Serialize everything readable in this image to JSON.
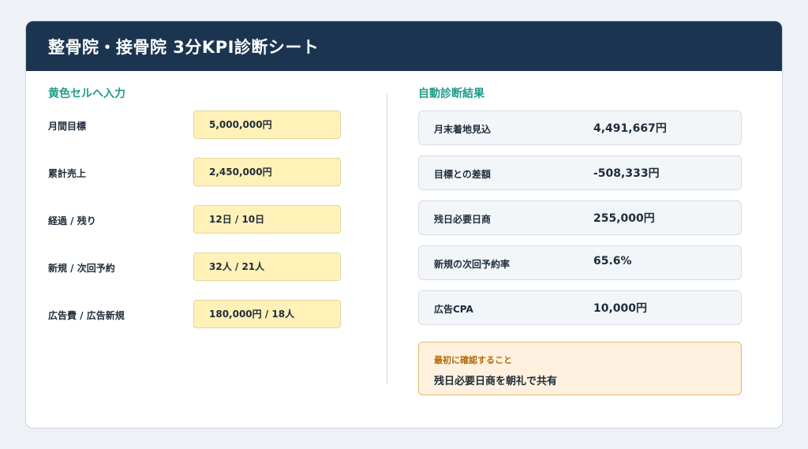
{
  "header": {
    "title": "整骨院・接骨院 3分KPI診断シート"
  },
  "input_section": {
    "title": "黄色セルへ入力",
    "rows": [
      {
        "label": "月間目標",
        "value": "5,000,000円"
      },
      {
        "label": "累計売上",
        "value": "2,450,000円"
      },
      {
        "label": "経過 / 残り",
        "value": "12日 / 10日"
      },
      {
        "label": "新規 / 次回予約",
        "value": "32人 / 21人"
      },
      {
        "label": "広告費 / 広告新規",
        "value": "180,000円 / 18人"
      }
    ]
  },
  "result_section": {
    "title": "自動診断結果",
    "rows": [
      {
        "label": "月末着地見込",
        "value": "4,491,667円"
      },
      {
        "label": "目標との差額",
        "value": "-508,333円"
      },
      {
        "label": "残日必要日商",
        "value": "255,000円"
      },
      {
        "label": "新規の次回予約率",
        "value": "65.6%"
      },
      {
        "label": "広告CPA",
        "value": "10,000円"
      }
    ]
  },
  "notice": {
    "title": "最初に確認すること",
    "text": "残日必要日商を朝礼で共有"
  },
  "colors": {
    "header_bg": "#1b3550",
    "section_title": "#1f9c8a",
    "input_cell": "#fff1b8",
    "notice_bg": "#fff1de",
    "notice_title": "#b0690c"
  }
}
